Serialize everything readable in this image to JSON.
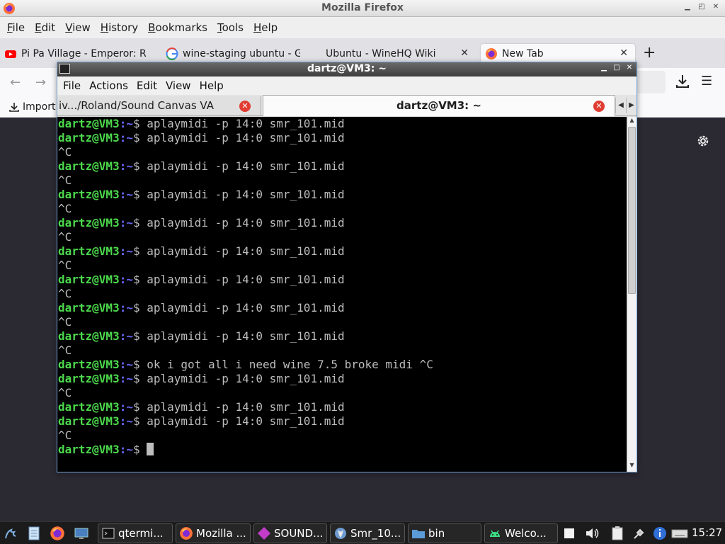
{
  "firefox": {
    "window_title": "Mozilla Firefox",
    "menu": [
      {
        "label": "File",
        "u": "F",
        "rest": "ile"
      },
      {
        "label": "Edit",
        "u": "E",
        "rest": "dit"
      },
      {
        "label": "View",
        "u": "V",
        "rest": "iew"
      },
      {
        "label": "History",
        "u": "H",
        "rest": "istory"
      },
      {
        "label": "Bookmarks",
        "u": "B",
        "rest": "ookmarks"
      },
      {
        "label": "Tools",
        "u": "T",
        "rest": "ools"
      },
      {
        "label": "Help",
        "u": "H",
        "rest": "elp"
      }
    ],
    "tabs": [
      {
        "label": "Pi Pa Village - Emperor: R",
        "icon": "youtube-icon"
      },
      {
        "label": "wine-staging ubuntu - Go",
        "icon": "google-icon"
      },
      {
        "label": "Ubuntu - WineHQ Wiki",
        "icon": "none"
      },
      {
        "label": "New Tab",
        "icon": "firefox-icon"
      }
    ],
    "bookmarks_import": "Import"
  },
  "terminal": {
    "title": "dartz@VM3: ~",
    "menu": [
      "File",
      "Actions",
      "Edit",
      "View",
      "Help"
    ],
    "tab_inactive": "iv.../Roland/Sound Canvas VA",
    "tab_active": "dartz@VM3: ~",
    "prompt_user": "dartz@VM3",
    "prompt_path": ":~",
    "prompt_symbol": "$",
    "lines": [
      {
        "type": "prompt",
        "cmd": "aplaymidi -p 14:0 smr_101.mid"
      },
      {
        "type": "prompt",
        "cmd": "aplaymidi -p 14:0 smr_101.mid"
      },
      {
        "type": "out",
        "text": "^C"
      },
      {
        "type": "prompt",
        "cmd": "aplaymidi -p 14:0 smr_101.mid"
      },
      {
        "type": "out",
        "text": "^C"
      },
      {
        "type": "prompt",
        "cmd": "aplaymidi -p 14:0 smr_101.mid"
      },
      {
        "type": "out",
        "text": "^C"
      },
      {
        "type": "prompt",
        "cmd": "aplaymidi -p 14:0 smr_101.mid"
      },
      {
        "type": "out",
        "text": "^C"
      },
      {
        "type": "prompt",
        "cmd": "aplaymidi -p 14:0 smr_101.mid"
      },
      {
        "type": "out",
        "text": "^C"
      },
      {
        "type": "prompt",
        "cmd": "aplaymidi -p 14:0 smr_101.mid"
      },
      {
        "type": "out",
        "text": "^C"
      },
      {
        "type": "prompt",
        "cmd": "aplaymidi -p 14:0 smr_101.mid"
      },
      {
        "type": "out",
        "text": "^C"
      },
      {
        "type": "prompt",
        "cmd": "aplaymidi -p 14:0 smr_101.mid"
      },
      {
        "type": "out",
        "text": "^C"
      },
      {
        "type": "prompt",
        "cmd": "ok i got all i need wine 7.5 broke midi ^C"
      },
      {
        "type": "prompt",
        "cmd": "aplaymidi -p 14:0 smr_101.mid"
      },
      {
        "type": "out",
        "text": "^C"
      },
      {
        "type": "prompt",
        "cmd": "aplaymidi -p 14:0 smr_101.mid"
      },
      {
        "type": "prompt",
        "cmd": "aplaymidi -p 14:0 smr_101.mid"
      },
      {
        "type": "out",
        "text": "^C"
      },
      {
        "type": "prompt",
        "cmd": "",
        "cursor": true
      }
    ]
  },
  "taskbar": {
    "windows": [
      {
        "label": "qtermi...",
        "icon": "terminal-icon"
      },
      {
        "label": "Mozilla ...",
        "icon": "firefox-icon"
      },
      {
        "label": "SOUND...",
        "icon": "sound-canvas-icon"
      },
      {
        "label": "Smr_10...",
        "icon": "wine-icon"
      },
      {
        "label": "bin",
        "icon": "folder-icon"
      },
      {
        "label": "Welco...",
        "icon": "android-icon"
      }
    ],
    "clock": "15:27"
  },
  "colors": {
    "prompt_user": "#4cd84c",
    "prompt_path": "#6a6aff",
    "terminal_bg": "#000000",
    "terminal_fg": "#bdbdbd",
    "close_red": "#e03c31"
  }
}
